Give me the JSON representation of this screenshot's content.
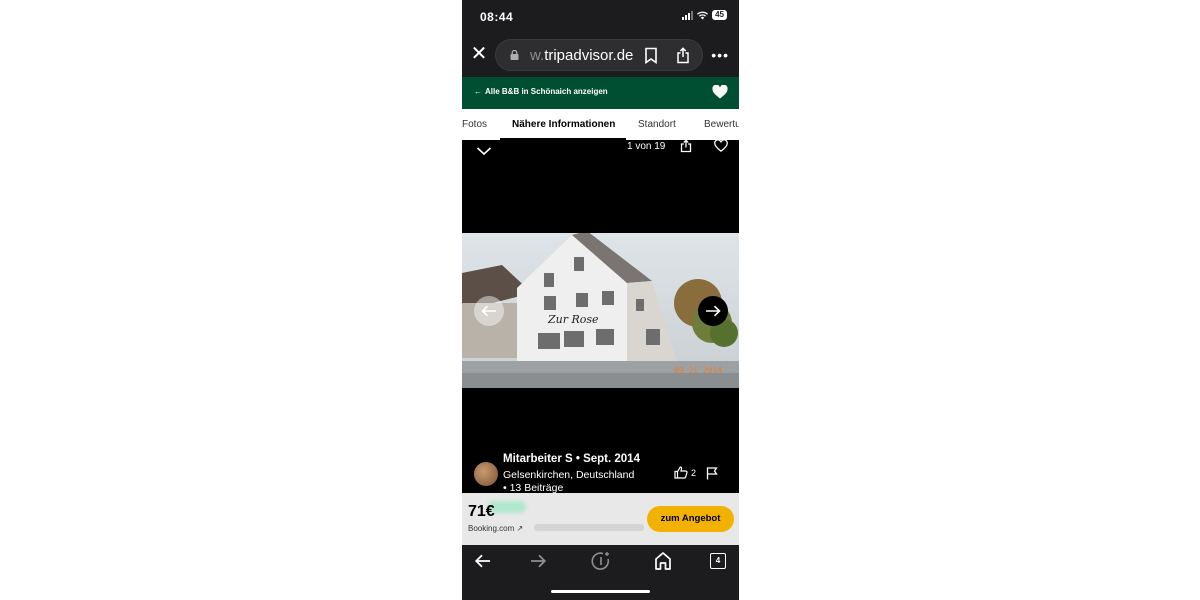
{
  "status_bar": {
    "time": "08:44",
    "battery": "45"
  },
  "browser": {
    "url_faded": "w.",
    "url_main": "tripadvisor.de"
  },
  "header": {
    "back_link": "Alle B&B in Schönaich anzeigen"
  },
  "tabs": [
    {
      "label": "Fotos"
    },
    {
      "label": "Nähere Informationen",
      "active": true
    },
    {
      "label": "Standort"
    },
    {
      "label": "Bewertungen"
    }
  ],
  "viewer": {
    "counter": "1 von 19",
    "sign_text": "Zur Rose",
    "photo_date": "09 21 2014"
  },
  "review": {
    "author_line": "Mitarbeiter S • Sept. 2014",
    "location": "Gelsenkirchen, Deutschland",
    "contributions": "•  13 Beiträge",
    "likes": "2"
  },
  "offer": {
    "price": "71€",
    "provider": "Booking.com ↗",
    "button_label": "zum Angebot"
  },
  "toolbar": {
    "tab_count": "4"
  },
  "colors": {
    "brand_green": "#004f32",
    "offer_yellow": "#f2b203"
  }
}
